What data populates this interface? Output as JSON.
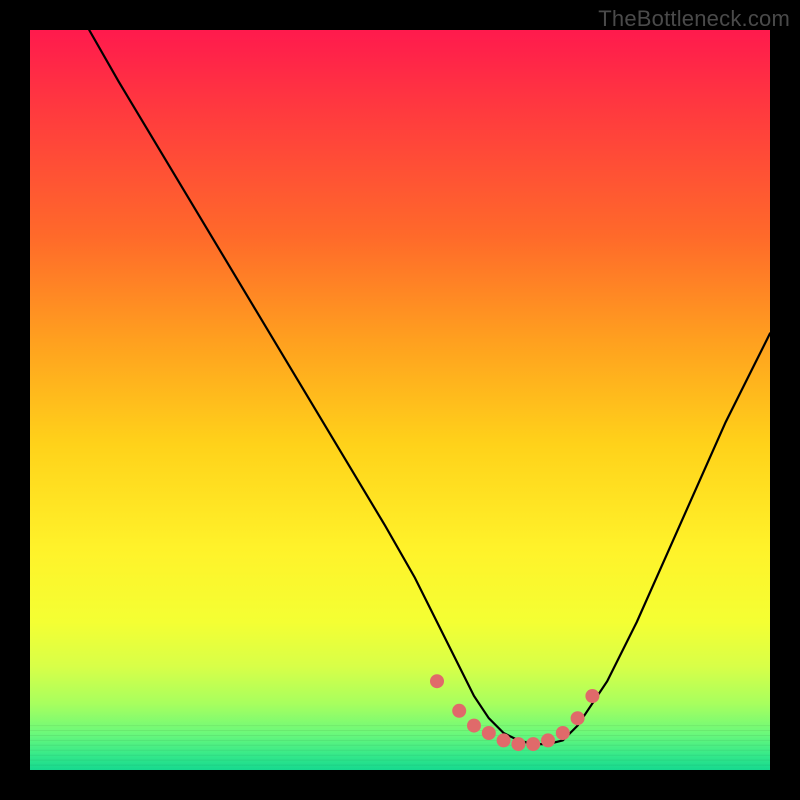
{
  "watermark": "TheBottleneck.com",
  "chart_data": {
    "type": "line",
    "title": "",
    "xlabel": "",
    "ylabel": "",
    "xlim": [
      0,
      100
    ],
    "ylim": [
      0,
      100
    ],
    "series": [
      {
        "name": "curve",
        "x": [
          8,
          12,
          18,
          24,
          30,
          36,
          42,
          48,
          52,
          55,
          58,
          60,
          62,
          64,
          66,
          68,
          70,
          72,
          74,
          78,
          82,
          86,
          90,
          94,
          98,
          100
        ],
        "values": [
          100,
          93,
          83,
          73,
          63,
          53,
          43,
          33,
          26,
          20,
          14,
          10,
          7,
          5,
          4,
          3.5,
          3.5,
          4,
          6,
          12,
          20,
          29,
          38,
          47,
          55,
          59
        ]
      }
    ],
    "markers": {
      "name": "highlight-dots",
      "color": "#e06a6a",
      "x": [
        55,
        58,
        60,
        62,
        64,
        66,
        68,
        70,
        72,
        74,
        76
      ],
      "values": [
        12,
        8,
        6,
        5,
        4,
        3.5,
        3.5,
        4,
        5,
        7,
        10
      ]
    },
    "gradient_stops": [
      {
        "pos": 0,
        "color": "#ff1a4d"
      },
      {
        "pos": 12,
        "color": "#ff3d3d"
      },
      {
        "pos": 28,
        "color": "#ff6a2a"
      },
      {
        "pos": 42,
        "color": "#ffa01f"
      },
      {
        "pos": 56,
        "color": "#ffd21a"
      },
      {
        "pos": 70,
        "color": "#fff22a"
      },
      {
        "pos": 80,
        "color": "#f4ff33"
      },
      {
        "pos": 86,
        "color": "#d8ff48"
      },
      {
        "pos": 91,
        "color": "#a8ff5e"
      },
      {
        "pos": 95,
        "color": "#6cf97a"
      },
      {
        "pos": 98,
        "color": "#35e98a"
      },
      {
        "pos": 100,
        "color": "#17d98f"
      }
    ],
    "bottom_bands": {
      "start_y": 94,
      "count": 9,
      "note": "thin horizontal striations near bottom of gradient"
    }
  }
}
